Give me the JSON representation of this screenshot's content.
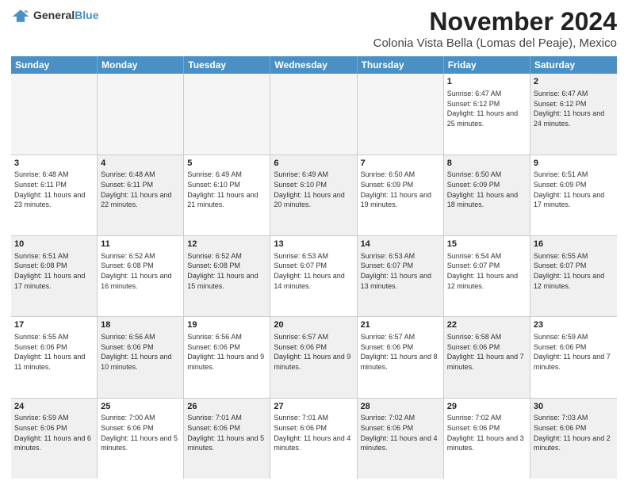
{
  "logo": {
    "general": "General",
    "blue": "Blue"
  },
  "header": {
    "title": "November 2024",
    "subtitle": "Colonia Vista Bella (Lomas del Peaje), Mexico"
  },
  "weekdays": [
    "Sunday",
    "Monday",
    "Tuesday",
    "Wednesday",
    "Thursday",
    "Friday",
    "Saturday"
  ],
  "rows": [
    [
      {
        "day": "",
        "empty": true
      },
      {
        "day": "",
        "empty": true
      },
      {
        "day": "",
        "empty": true
      },
      {
        "day": "",
        "empty": true
      },
      {
        "day": "",
        "empty": true
      },
      {
        "day": "1",
        "sunrise": "Sunrise: 6:47 AM",
        "sunset": "Sunset: 6:12 PM",
        "daylight": "Daylight: 11 hours and 25 minutes."
      },
      {
        "day": "2",
        "sunrise": "Sunrise: 6:47 AM",
        "sunset": "Sunset: 6:12 PM",
        "daylight": "Daylight: 11 hours and 24 minutes.",
        "shaded": true
      }
    ],
    [
      {
        "day": "3",
        "sunrise": "Sunrise: 6:48 AM",
        "sunset": "Sunset: 6:11 PM",
        "daylight": "Daylight: 11 hours and 23 minutes."
      },
      {
        "day": "4",
        "sunrise": "Sunrise: 6:48 AM",
        "sunset": "Sunset: 6:11 PM",
        "daylight": "Daylight: 11 hours and 22 minutes.",
        "shaded": true
      },
      {
        "day": "5",
        "sunrise": "Sunrise: 6:49 AM",
        "sunset": "Sunset: 6:10 PM",
        "daylight": "Daylight: 11 hours and 21 minutes."
      },
      {
        "day": "6",
        "sunrise": "Sunrise: 6:49 AM",
        "sunset": "Sunset: 6:10 PM",
        "daylight": "Daylight: 11 hours and 20 minutes.",
        "shaded": true
      },
      {
        "day": "7",
        "sunrise": "Sunrise: 6:50 AM",
        "sunset": "Sunset: 6:09 PM",
        "daylight": "Daylight: 11 hours and 19 minutes."
      },
      {
        "day": "8",
        "sunrise": "Sunrise: 6:50 AM",
        "sunset": "Sunset: 6:09 PM",
        "daylight": "Daylight: 11 hours and 18 minutes.",
        "shaded": true
      },
      {
        "day": "9",
        "sunrise": "Sunrise: 6:51 AM",
        "sunset": "Sunset: 6:09 PM",
        "daylight": "Daylight: 11 hours and 17 minutes."
      }
    ],
    [
      {
        "day": "10",
        "sunrise": "Sunrise: 6:51 AM",
        "sunset": "Sunset: 6:08 PM",
        "daylight": "Daylight: 11 hours and 17 minutes.",
        "shaded": true
      },
      {
        "day": "11",
        "sunrise": "Sunrise: 6:52 AM",
        "sunset": "Sunset: 6:08 PM",
        "daylight": "Daylight: 11 hours and 16 minutes."
      },
      {
        "day": "12",
        "sunrise": "Sunrise: 6:52 AM",
        "sunset": "Sunset: 6:08 PM",
        "daylight": "Daylight: 11 hours and 15 minutes.",
        "shaded": true
      },
      {
        "day": "13",
        "sunrise": "Sunrise: 6:53 AM",
        "sunset": "Sunset: 6:07 PM",
        "daylight": "Daylight: 11 hours and 14 minutes."
      },
      {
        "day": "14",
        "sunrise": "Sunrise: 6:53 AM",
        "sunset": "Sunset: 6:07 PM",
        "daylight": "Daylight: 11 hours and 13 minutes.",
        "shaded": true
      },
      {
        "day": "15",
        "sunrise": "Sunrise: 6:54 AM",
        "sunset": "Sunset: 6:07 PM",
        "daylight": "Daylight: 11 hours and 12 minutes."
      },
      {
        "day": "16",
        "sunrise": "Sunrise: 6:55 AM",
        "sunset": "Sunset: 6:07 PM",
        "daylight": "Daylight: 11 hours and 12 minutes.",
        "shaded": true
      }
    ],
    [
      {
        "day": "17",
        "sunrise": "Sunrise: 6:55 AM",
        "sunset": "Sunset: 6:06 PM",
        "daylight": "Daylight: 11 hours and 11 minutes."
      },
      {
        "day": "18",
        "sunrise": "Sunrise: 6:56 AM",
        "sunset": "Sunset: 6:06 PM",
        "daylight": "Daylight: 11 hours and 10 minutes.",
        "shaded": true
      },
      {
        "day": "19",
        "sunrise": "Sunrise: 6:56 AM",
        "sunset": "Sunset: 6:06 PM",
        "daylight": "Daylight: 11 hours and 9 minutes."
      },
      {
        "day": "20",
        "sunrise": "Sunrise: 6:57 AM",
        "sunset": "Sunset: 6:06 PM",
        "daylight": "Daylight: 11 hours and 9 minutes.",
        "shaded": true
      },
      {
        "day": "21",
        "sunrise": "Sunrise: 6:57 AM",
        "sunset": "Sunset: 6:06 PM",
        "daylight": "Daylight: 11 hours and 8 minutes."
      },
      {
        "day": "22",
        "sunrise": "Sunrise: 6:58 AM",
        "sunset": "Sunset: 6:06 PM",
        "daylight": "Daylight: 11 hours and 7 minutes.",
        "shaded": true
      },
      {
        "day": "23",
        "sunrise": "Sunrise: 6:59 AM",
        "sunset": "Sunset: 6:06 PM",
        "daylight": "Daylight: 11 hours and 7 minutes."
      }
    ],
    [
      {
        "day": "24",
        "sunrise": "Sunrise: 6:59 AM",
        "sunset": "Sunset: 6:06 PM",
        "daylight": "Daylight: 11 hours and 6 minutes.",
        "shaded": true
      },
      {
        "day": "25",
        "sunrise": "Sunrise: 7:00 AM",
        "sunset": "Sunset: 6:06 PM",
        "daylight": "Daylight: 11 hours and 5 minutes."
      },
      {
        "day": "26",
        "sunrise": "Sunrise: 7:01 AM",
        "sunset": "Sunset: 6:06 PM",
        "daylight": "Daylight: 11 hours and 5 minutes.",
        "shaded": true
      },
      {
        "day": "27",
        "sunrise": "Sunrise: 7:01 AM",
        "sunset": "Sunset: 6:06 PM",
        "daylight": "Daylight: 11 hours and 4 minutes."
      },
      {
        "day": "28",
        "sunrise": "Sunrise: 7:02 AM",
        "sunset": "Sunset: 6:06 PM",
        "daylight": "Daylight: 11 hours and 4 minutes.",
        "shaded": true
      },
      {
        "day": "29",
        "sunrise": "Sunrise: 7:02 AM",
        "sunset": "Sunset: 6:06 PM",
        "daylight": "Daylight: 11 hours and 3 minutes."
      },
      {
        "day": "30",
        "sunrise": "Sunrise: 7:03 AM",
        "sunset": "Sunset: 6:06 PM",
        "daylight": "Daylight: 11 hours and 2 minutes.",
        "shaded": true
      }
    ]
  ]
}
